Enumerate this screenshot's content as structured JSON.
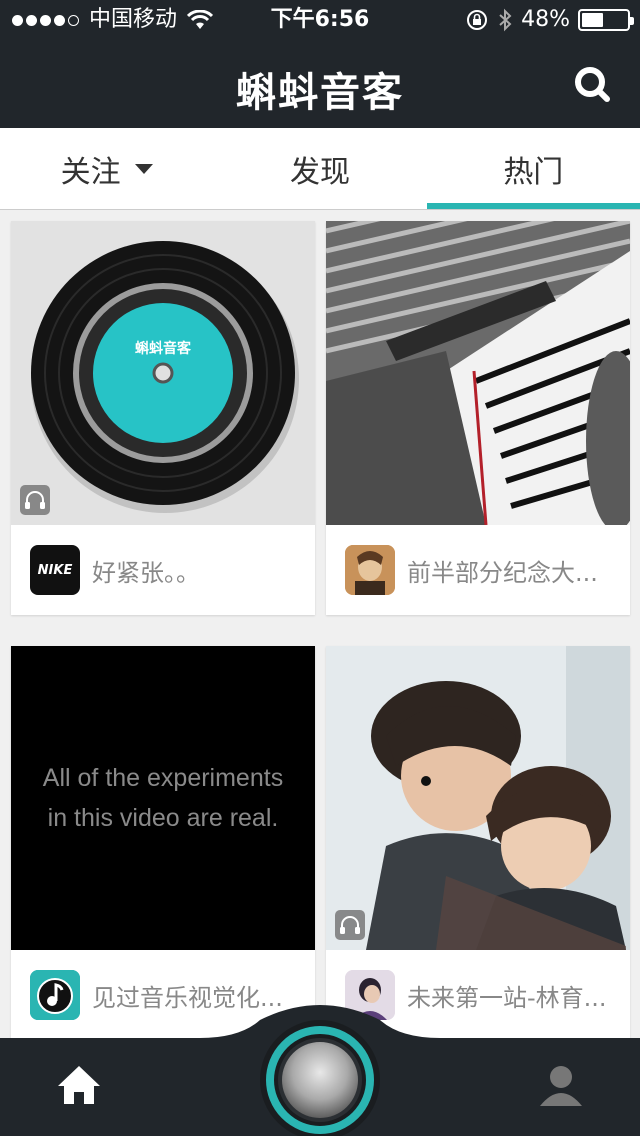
{
  "status_bar": {
    "carrier": "中国移动",
    "time": "下午6:56",
    "battery": "48%",
    "battery_level": 0.48,
    "icons": [
      "signal-dots-icon",
      "wifi-icon",
      "rotation-lock-icon",
      "bluetooth-icon",
      "battery-icon"
    ]
  },
  "nav": {
    "title": "蝌蚪音客",
    "search_icon": "search-icon"
  },
  "tabs": [
    {
      "label": "关注",
      "has_dropdown": true,
      "active": false
    },
    {
      "label": "发现",
      "has_dropdown": false,
      "active": false
    },
    {
      "label": "热门",
      "has_dropdown": false,
      "active": true
    }
  ],
  "colors": {
    "header_bg": "#21262b",
    "accent": "#2ab5b2",
    "page_bg": "#f0f0f0"
  },
  "feed": {
    "cards": [
      {
        "title": "好紧张。。",
        "thumbnail": "vinyl-record",
        "record_label": "蝌蚪音客",
        "avatar_text": "NIKE",
        "has_audio_badge": true
      },
      {
        "title": "前半部分纪念大...",
        "thumbnail": "piano-keys",
        "avatar": "portrait-avatar",
        "has_audio_badge": false
      },
      {
        "title": "见过音乐视觉化...",
        "thumbnail": "black-video-frame",
        "video_text_line1": "All of the experiments",
        "video_text_line2": "in this video are real.",
        "avatar": "music-note-avatar",
        "has_audio_badge": false
      },
      {
        "title": "未来第一站-林育...",
        "thumbnail": "two-people-photo",
        "avatar": "person-avatar",
        "has_audio_badge": true
      }
    ]
  },
  "bottom_bar": {
    "icons": [
      "home-icon",
      "player-knob-icon",
      "profile-icon"
    ]
  }
}
